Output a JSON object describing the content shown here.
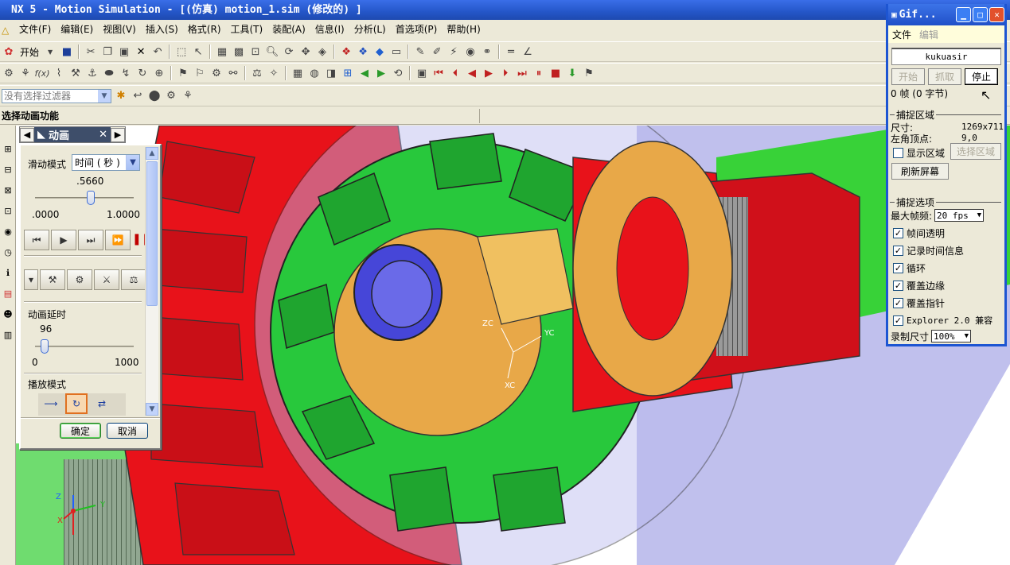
{
  "window_title": "NX 5 - Motion Simulation - [(仿真) motion_1.sim (修改的) ]",
  "menu": [
    "文件(F)",
    "编辑(E)",
    "视图(V)",
    "插入(S)",
    "格式(R)",
    "工具(T)",
    "装配(A)",
    "信息(I)",
    "分析(L)",
    "首选项(P)",
    "帮助(H)"
  ],
  "toolbar": {
    "start_label": "开始"
  },
  "selection_filter": {
    "placeholder": "没有选择过滤器"
  },
  "cue_line": "选择动画功能",
  "animation_dialog": {
    "tab_title": "动画",
    "slide_mode_label": "滑动模式",
    "slide_mode_value": "时间 ( 秒 )",
    "time_value": ".5660",
    "time_fraction": 0.566,
    "time_min": ".0000",
    "time_max": "1.0000",
    "delay_label": "动画延时",
    "delay_value": "96",
    "delay_min": "0",
    "delay_max": "1000",
    "delay_fraction": 0.096,
    "play_mode_label": "播放模式",
    "ok_label": "确定",
    "cancel_label": "取消"
  },
  "gif_window": {
    "title": "Gif...",
    "menu_file": "文件",
    "menu_edit": "编辑",
    "name": "kukuasir",
    "btn_start": "开始",
    "btn_capture": "抓取",
    "btn_stop": "停止",
    "frames_text": "0 帧 (0 字节)",
    "capture_area_heading": "捕捉区域",
    "size_label": "尺寸:",
    "size_value": "1269x711",
    "topleft_label": "左角顶点:",
    "topleft_value": "9,0",
    "show_area_label": "显示区域",
    "select_area_label": "选择区域",
    "refresh_label": "刷新屏幕",
    "capture_options_heading": "捕捉选项",
    "max_fps_label": "最大帧频:",
    "max_fps_value": "20 fps",
    "options": [
      "帧间透明",
      "记录时间信息",
      "循环",
      "覆盖边缘",
      "覆盖指针",
      "Explorer 2.0 兼容"
    ],
    "record_size_label": "录制尺寸",
    "record_size_value": "100%"
  },
  "viewport": {
    "csys_labels": [
      "ZC",
      "YC",
      "XC"
    ],
    "triad_labels": [
      "Z",
      "Y",
      "X"
    ]
  },
  "colors": {
    "red_gear": "#e8121a",
    "green_gear": "#2ad040",
    "orange_hub": "#e8a848",
    "blue_shaft": "#4646d8",
    "translucent_housing": "#a9a9e8",
    "xp_blue": "#2456c8"
  }
}
